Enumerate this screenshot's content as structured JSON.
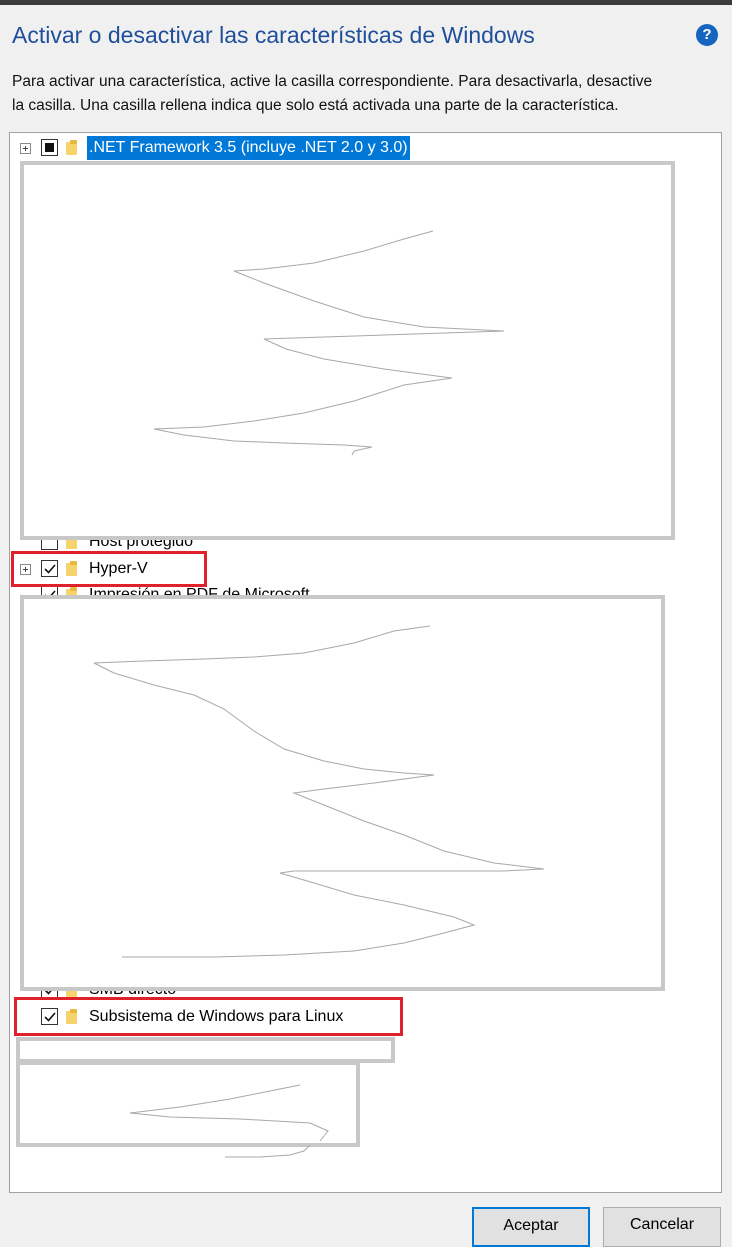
{
  "window": {
    "title": "Activar o desactivar las características de Windows",
    "help_glyph": "?",
    "description_line1": "Para activar una característica, active la casilla correspondiente. Para desactivarla, desactive",
    "description_line2": "la casilla. Una casilla rellena indica que solo está activada una parte de la característica."
  },
  "features": {
    "net35": {
      "label": ".NET Framework 3.5 (incluye .NET 2.0 y 3.0)",
      "state": "partial",
      "expandable": true,
      "selected": true
    },
    "host_protegido": {
      "label": "Host protegido",
      "state": "unchecked"
    },
    "hyperv": {
      "label": "Hyper-V",
      "state": "checked",
      "expandable": true,
      "highlighted": true
    },
    "impresion_pdf": {
      "label": "Impresión en PDF de Microsoft",
      "state": "checked"
    },
    "smb_directo": {
      "label": "SMB directo",
      "state": "checked"
    },
    "wsl": {
      "label": "Subsistema de Windows para Linux",
      "state": "checked",
      "highlighted": true
    }
  },
  "buttons": {
    "ok_label": "Aceptar",
    "cancel_label": "Cancelar"
  },
  "colors": {
    "title": "#1f4e9b",
    "selection": "#0078d7",
    "highlight_box": "#e0202a",
    "folder": "#f7d36b"
  },
  "icons": [
    "help-icon",
    "expander-plus-icon",
    "checkbox-partial-icon",
    "checkbox-checked-icon",
    "folder-icon"
  ]
}
